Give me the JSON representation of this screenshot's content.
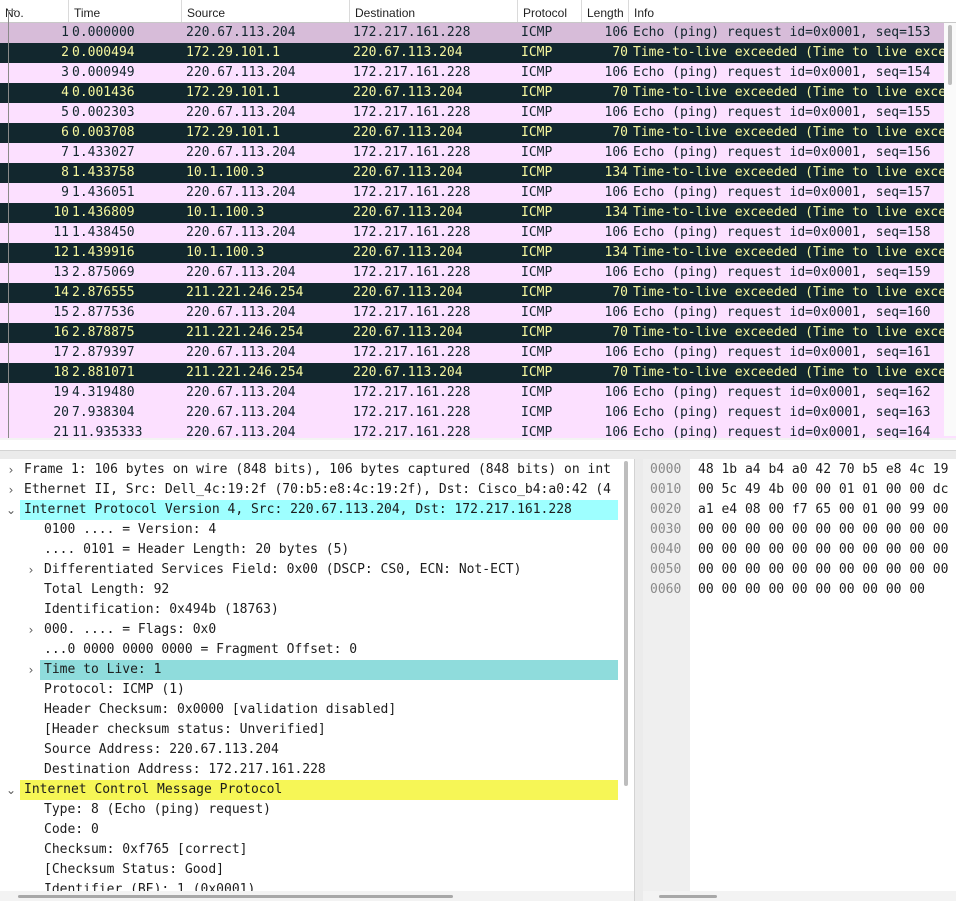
{
  "columns": [
    "No.",
    "Time",
    "Source",
    "Destination",
    "Protocol",
    "Length",
    "Info"
  ],
  "packets": [
    {
      "no": "1",
      "time": "0.000000",
      "src": "220.67.113.204",
      "dst": "172.217.161.228",
      "proto": "ICMP",
      "len": "106",
      "info": "Echo (ping) request  id=0x0001, seq=153",
      "type": "selected"
    },
    {
      "no": "2",
      "time": "0.000494",
      "src": "172.29.101.1",
      "dst": "220.67.113.204",
      "proto": "ICMP",
      "len": "70",
      "info": "Time-to-live exceeded (Time to live exceeded",
      "type": "ttl"
    },
    {
      "no": "3",
      "time": "0.000949",
      "src": "220.67.113.204",
      "dst": "172.217.161.228",
      "proto": "ICMP",
      "len": "106",
      "info": "Echo (ping) request  id=0x0001, seq=154",
      "type": "ok"
    },
    {
      "no": "4",
      "time": "0.001436",
      "src": "172.29.101.1",
      "dst": "220.67.113.204",
      "proto": "ICMP",
      "len": "70",
      "info": "Time-to-live exceeded (Time to live exceeded",
      "type": "ttl"
    },
    {
      "no": "5",
      "time": "0.002303",
      "src": "220.67.113.204",
      "dst": "172.217.161.228",
      "proto": "ICMP",
      "len": "106",
      "info": "Echo (ping) request  id=0x0001, seq=155",
      "type": "ok"
    },
    {
      "no": "6",
      "time": "0.003708",
      "src": "172.29.101.1",
      "dst": "220.67.113.204",
      "proto": "ICMP",
      "len": "70",
      "info": "Time-to-live exceeded (Time to live exceeded",
      "type": "ttl"
    },
    {
      "no": "7",
      "time": "1.433027",
      "src": "220.67.113.204",
      "dst": "172.217.161.228",
      "proto": "ICMP",
      "len": "106",
      "info": "Echo (ping) request  id=0x0001, seq=156",
      "type": "ok"
    },
    {
      "no": "8",
      "time": "1.433758",
      "src": "10.1.100.3",
      "dst": "220.67.113.204",
      "proto": "ICMP",
      "len": "134",
      "info": "Time-to-live exceeded (Time to live exceeded",
      "type": "ttl"
    },
    {
      "no": "9",
      "time": "1.436051",
      "src": "220.67.113.204",
      "dst": "172.217.161.228",
      "proto": "ICMP",
      "len": "106",
      "info": "Echo (ping) request  id=0x0001, seq=157",
      "type": "ok"
    },
    {
      "no": "10",
      "time": "1.436809",
      "src": "10.1.100.3",
      "dst": "220.67.113.204",
      "proto": "ICMP",
      "len": "134",
      "info": "Time-to-live exceeded (Time to live exceeded",
      "type": "ttl"
    },
    {
      "no": "11",
      "time": "1.438450",
      "src": "220.67.113.204",
      "dst": "172.217.161.228",
      "proto": "ICMP",
      "len": "106",
      "info": "Echo (ping) request  id=0x0001, seq=158",
      "type": "ok"
    },
    {
      "no": "12",
      "time": "1.439916",
      "src": "10.1.100.3",
      "dst": "220.67.113.204",
      "proto": "ICMP",
      "len": "134",
      "info": "Time-to-live exceeded (Time to live exceeded",
      "type": "ttl"
    },
    {
      "no": "13",
      "time": "2.875069",
      "src": "220.67.113.204",
      "dst": "172.217.161.228",
      "proto": "ICMP",
      "len": "106",
      "info": "Echo (ping) request  id=0x0001, seq=159",
      "type": "ok"
    },
    {
      "no": "14",
      "time": "2.876555",
      "src": "211.221.246.254",
      "dst": "220.67.113.204",
      "proto": "ICMP",
      "len": "70",
      "info": "Time-to-live exceeded (Time to live exceeded",
      "type": "ttl"
    },
    {
      "no": "15",
      "time": "2.877536",
      "src": "220.67.113.204",
      "dst": "172.217.161.228",
      "proto": "ICMP",
      "len": "106",
      "info": "Echo (ping) request  id=0x0001, seq=160",
      "type": "ok"
    },
    {
      "no": "16",
      "time": "2.878875",
      "src": "211.221.246.254",
      "dst": "220.67.113.204",
      "proto": "ICMP",
      "len": "70",
      "info": "Time-to-live exceeded (Time to live exceeded",
      "type": "ttl"
    },
    {
      "no": "17",
      "time": "2.879397",
      "src": "220.67.113.204",
      "dst": "172.217.161.228",
      "proto": "ICMP",
      "len": "106",
      "info": "Echo (ping) request  id=0x0001, seq=161",
      "type": "ok"
    },
    {
      "no": "18",
      "time": "2.881071",
      "src": "211.221.246.254",
      "dst": "220.67.113.204",
      "proto": "ICMP",
      "len": "70",
      "info": "Time-to-live exceeded (Time to live exceeded",
      "type": "ttl"
    },
    {
      "no": "19",
      "time": "4.319480",
      "src": "220.67.113.204",
      "dst": "172.217.161.228",
      "proto": "ICMP",
      "len": "106",
      "info": "Echo (ping) request  id=0x0001, seq=162",
      "type": "ok"
    },
    {
      "no": "20",
      "time": "7.938304",
      "src": "220.67.113.204",
      "dst": "172.217.161.228",
      "proto": "ICMP",
      "len": "106",
      "info": "Echo (ping) request  id=0x0001, seq=163",
      "type": "ok"
    },
    {
      "no": "21",
      "time": "11.935333",
      "src": "220.67.113.204",
      "dst": "172.217.161.228",
      "proto": "ICMP",
      "len": "106",
      "info": "Echo (ping) request  id=0x0001, seq=164",
      "type": "ok"
    }
  ],
  "details": [
    {
      "level": 0,
      "arrow": "›",
      "text": "Frame 1: 106 bytes on wire (848 bits), 106 bytes captured (848 bits) on int",
      "hl": ""
    },
    {
      "level": 0,
      "arrow": "›",
      "text": "Ethernet II, Src: Dell_4c:19:2f (70:b5:e8:4c:19:2f), Dst: Cisco_b4:a0:42 (4",
      "hl": ""
    },
    {
      "level": 0,
      "arrow": "⌄",
      "text": "Internet Protocol Version 4, Src: 220.67.113.204, Dst: 172.217.161.228",
      "hl": "cyan"
    },
    {
      "level": 1,
      "arrow": "",
      "text": "0100 .... = Version: 4",
      "hl": ""
    },
    {
      "level": 1,
      "arrow": "",
      "text": ".... 0101 = Header Length: 20 bytes (5)",
      "hl": ""
    },
    {
      "level": 1,
      "arrow": "›",
      "text": "Differentiated Services Field: 0x00 (DSCP: CS0, ECN: Not-ECT)",
      "hl": ""
    },
    {
      "level": 1,
      "arrow": "",
      "text": "Total Length: 92",
      "hl": ""
    },
    {
      "level": 1,
      "arrow": "",
      "text": "Identification: 0x494b (18763)",
      "hl": ""
    },
    {
      "level": 1,
      "arrow": "›",
      "text": "000. .... = Flags: 0x0",
      "hl": ""
    },
    {
      "level": 1,
      "arrow": "",
      "text": "...0 0000 0000 0000 = Fragment Offset: 0",
      "hl": ""
    },
    {
      "level": 1,
      "arrow": "›",
      "text": "Time to Live: 1",
      "hl": "teal"
    },
    {
      "level": 1,
      "arrow": "",
      "text": "Protocol: ICMP (1)",
      "hl": ""
    },
    {
      "level": 1,
      "arrow": "",
      "text": "Header Checksum: 0x0000 [validation disabled]",
      "hl": ""
    },
    {
      "level": 1,
      "arrow": "",
      "text": "[Header checksum status: Unverified]",
      "hl": ""
    },
    {
      "level": 1,
      "arrow": "",
      "text": "Source Address: 220.67.113.204",
      "hl": ""
    },
    {
      "level": 1,
      "arrow": "",
      "text": "Destination Address: 172.217.161.228",
      "hl": ""
    },
    {
      "level": 0,
      "arrow": "⌄",
      "text": "Internet Control Message Protocol",
      "hl": "yellow"
    },
    {
      "level": 1,
      "arrow": "",
      "text": "Type: 8 (Echo (ping) request)",
      "hl": ""
    },
    {
      "level": 1,
      "arrow": "",
      "text": "Code: 0",
      "hl": ""
    },
    {
      "level": 1,
      "arrow": "",
      "text": "Checksum: 0xf765 [correct]",
      "hl": ""
    },
    {
      "level": 1,
      "arrow": "",
      "text": "[Checksum Status: Good]",
      "hl": ""
    },
    {
      "level": 1,
      "arrow": "",
      "text": "Identifier (BE): 1 (0x0001)",
      "hl": ""
    }
  ],
  "bytes": [
    {
      "offset": "0000",
      "hex": "48 1b a4 b4 a0 42 70 b5  e8 4c 19"
    },
    {
      "offset": "0010",
      "hex": "00 5c 49 4b 00 00 01 01  00 00 dc"
    },
    {
      "offset": "0020",
      "hex": "a1 e4 08 00 f7 65 00 01  00 99 00"
    },
    {
      "offset": "0030",
      "hex": "00 00 00 00 00 00 00 00  00 00 00"
    },
    {
      "offset": "0040",
      "hex": "00 00 00 00 00 00 00 00  00 00 00"
    },
    {
      "offset": "0050",
      "hex": "00 00 00 00 00 00 00 00  00 00 00"
    },
    {
      "offset": "0060",
      "hex": "00 00 00 00 00 00 00 00  00 00"
    }
  ],
  "colors": {
    "echo_row": "#fce0ff",
    "ttl_row": "#12272e",
    "ttl_text": "#f7f7a0",
    "selected_row": "#d7bcd9",
    "ipv4_highlight": "#9effff",
    "ttl_field_highlight": "#8fdcdc",
    "icmp_highlight": "#f6f656"
  }
}
